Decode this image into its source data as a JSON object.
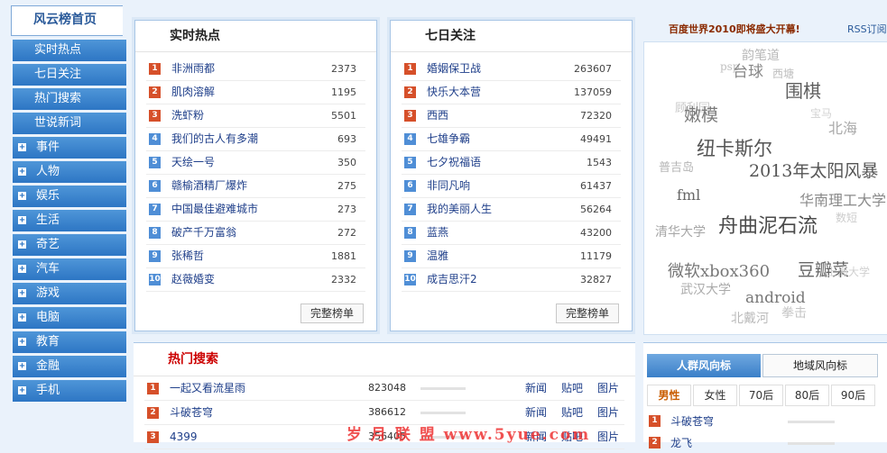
{
  "sidebar": {
    "home": "风云榜首页",
    "subs": [
      "实时热点",
      "七日关注",
      "热门搜索",
      "世说新词"
    ],
    "cats": [
      "事件",
      "人物",
      "娱乐",
      "生活",
      "奇艺",
      "汽车",
      "游戏",
      "电脑",
      "教育",
      "金融",
      "手机"
    ]
  },
  "realtime": {
    "title": "实时热点",
    "items": [
      {
        "rank": "1",
        "keyword": "非洲雨都",
        "count": "2373"
      },
      {
        "rank": "2",
        "keyword": "肌肉溶解",
        "count": "1195"
      },
      {
        "rank": "3",
        "keyword": "洗虾粉",
        "count": "5501"
      },
      {
        "rank": "4",
        "keyword": "我们的古人有多潮",
        "count": "693"
      },
      {
        "rank": "5",
        "keyword": "天绘一号",
        "count": "350"
      },
      {
        "rank": "6",
        "keyword": "赣榆酒精厂爆炸",
        "count": "275"
      },
      {
        "rank": "7",
        "keyword": "中国最佳避难城市",
        "count": "273"
      },
      {
        "rank": "8",
        "keyword": "破产千万富翁",
        "count": "272"
      },
      {
        "rank": "9",
        "keyword": "张稀哲",
        "count": "1881"
      },
      {
        "rank": "10",
        "keyword": "赵薇婚变",
        "count": "2332"
      }
    ],
    "button": "完整榜单"
  },
  "weekly": {
    "title": "七日关注",
    "items": [
      {
        "rank": "1",
        "keyword": "婚姻保卫战",
        "count": "263607"
      },
      {
        "rank": "2",
        "keyword": "快乐大本营",
        "count": "137059"
      },
      {
        "rank": "3",
        "keyword": "西西",
        "count": "72320"
      },
      {
        "rank": "4",
        "keyword": "七雄争霸",
        "count": "49491"
      },
      {
        "rank": "5",
        "keyword": "七夕祝福语",
        "count": "1543"
      },
      {
        "rank": "6",
        "keyword": "非同凡响",
        "count": "61437"
      },
      {
        "rank": "7",
        "keyword": "我的美丽人生",
        "count": "56264"
      },
      {
        "rank": "8",
        "keyword": "蓝燕",
        "count": "43200"
      },
      {
        "rank": "9",
        "keyword": "温雅",
        "count": "11179"
      },
      {
        "rank": "10",
        "keyword": "成吉思汗2",
        "count": "32827"
      }
    ],
    "button": "完整榜单"
  },
  "cloud": {
    "headline": "百度世界2010即将盛大开幕!",
    "rss": "RSS订阅",
    "tags": [
      {
        "text": "韵笔道",
        "color": "#b8b8b8"
      },
      {
        "text": "psp",
        "color": "#c0c0c0"
      },
      {
        "text": "台球",
        "color": "#888888"
      },
      {
        "text": "西塘",
        "color": "#bdbdbd"
      },
      {
        "text": "围棋",
        "color": "#5e5e5e"
      },
      {
        "text": "顾利园",
        "color": "#c8c8c8"
      },
      {
        "text": "嫩模",
        "color": "#7a7a7a"
      },
      {
        "text": "宝马",
        "color": "#d2d2d2"
      },
      {
        "text": "北海",
        "color": "#aaaaaa"
      },
      {
        "text": "纽卡斯尔",
        "color": "#555555"
      },
      {
        "text": "普吉岛",
        "color": "#b5b5b5"
      },
      {
        "text": "2013年太阳风暴",
        "color": "#555555"
      },
      {
        "text": "fml",
        "color": "#666666"
      },
      {
        "text": "华南理工大学",
        "color": "#8a8a8a"
      },
      {
        "text": "清华大学",
        "color": "#a6a6a6"
      },
      {
        "text": "舟曲泥石流",
        "color": "#4a4a4a"
      },
      {
        "text": "数短",
        "color": "#cccccc"
      },
      {
        "text": "微软xbox360",
        "color": "#777777"
      },
      {
        "text": "豆瓣菜",
        "color": "#666666"
      },
      {
        "text": "上海大学",
        "color": "#d0d0d0"
      },
      {
        "text": "武汉大学",
        "color": "#aaaaaa"
      },
      {
        "text": "android",
        "color": "#777777"
      },
      {
        "text": "北戴河",
        "color": "#bbbbbb"
      },
      {
        "text": "拳击",
        "color": "#c4c4c4"
      }
    ]
  },
  "hot_search": {
    "title": "热门搜索",
    "links": [
      "新闻",
      "贴吧",
      "图片"
    ],
    "items": [
      {
        "rank": "1",
        "keyword": "一起又看流星雨",
        "count": "823048"
      },
      {
        "rank": "2",
        "keyword": "斗破苍穹",
        "count": "386612"
      },
      {
        "rank": "3",
        "keyword": "4399",
        "count": "356405"
      }
    ]
  },
  "people": {
    "tab_active": "人群风向标",
    "tab_other": "地域风向标",
    "segments": [
      "男性",
      "女性",
      "70后",
      "80后",
      "90后"
    ],
    "items": [
      {
        "rank": "1",
        "keyword": "斗破苍穹"
      },
      {
        "rank": "2",
        "keyword": "龙飞"
      }
    ]
  },
  "watermark": "岁 月 联 盟 www.5yue.com",
  "colors": {
    "hot_rank": "#d6502a",
    "rank": "#4f8ed6",
    "sidebar": "#2d76c4",
    "link": "#1f3f8a"
  }
}
